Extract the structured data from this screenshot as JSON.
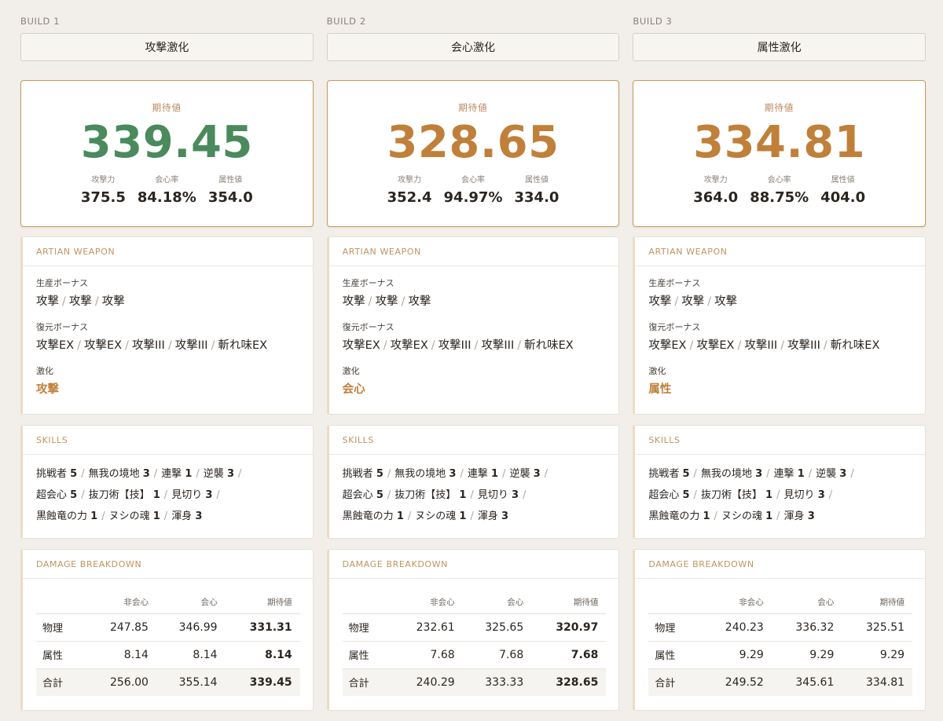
{
  "builds": [
    {
      "label": "BUILD 1",
      "name": "攻撃激化",
      "score_label": "期待値",
      "score": "339.45",
      "stats": [
        {
          "label": "攻撃力",
          "value": "375.5"
        },
        {
          "label": "会心率",
          "value": "84.18%"
        },
        {
          "label": "属性値",
          "value": "354.0"
        }
      ],
      "weapon": {
        "title": "ARTIAN WEAPON",
        "prod_label": "生産ボーナス",
        "prod": [
          "攻撃",
          "攻撃",
          "攻撃"
        ],
        "rest_label": "復元ボーナス",
        "rest": [
          "攻撃EX",
          "攻撃EX",
          "攻撃III",
          "攻撃III",
          "斬れ味EX"
        ],
        "gekika_label": "激化",
        "gekika": "攻撃"
      },
      "skills": {
        "title": "SKILLS",
        "lines": [
          [
            {
              "name": "挑戦者",
              "lv": "5"
            },
            {
              "name": "無我の境地",
              "lv": "3"
            },
            {
              "name": "連撃",
              "lv": "1"
            },
            {
              "name": "逆襲",
              "lv": "3"
            }
          ],
          [
            {
              "name": "超会心",
              "lv": "5"
            },
            {
              "name": "抜刀術【技】",
              "lv": "1"
            },
            {
              "name": "見切り",
              "lv": "3"
            }
          ],
          [
            {
              "name": "黒蝕竜の力",
              "lv": "1"
            },
            {
              "name": "ヌシの魂",
              "lv": "1"
            },
            {
              "name": "渾身",
              "lv": "3"
            }
          ]
        ]
      },
      "damage": {
        "title": "DAMAGE BREAKDOWN",
        "headers": [
          "",
          "非会心",
          "会心",
          "期待値"
        ],
        "rows": [
          {
            "label": "物理",
            "noncrit": "247.85",
            "crit": "346.99",
            "expected": "331.31"
          },
          {
            "label": "属性",
            "noncrit": "8.14",
            "crit": "8.14",
            "expected": "8.14"
          },
          {
            "label": "合計",
            "noncrit": "256.00",
            "crit": "355.14",
            "expected": "339.45"
          }
        ]
      }
    },
    {
      "label": "BUILD 2",
      "name": "会心激化",
      "score_label": "期待値",
      "score": "328.65",
      "stats": [
        {
          "label": "攻撃力",
          "value": "352.4"
        },
        {
          "label": "会心率",
          "value": "94.97%"
        },
        {
          "label": "属性値",
          "value": "334.0"
        }
      ],
      "weapon": {
        "title": "ARTIAN WEAPON",
        "prod_label": "生産ボーナス",
        "prod": [
          "攻撃",
          "攻撃",
          "攻撃"
        ],
        "rest_label": "復元ボーナス",
        "rest": [
          "攻撃EX",
          "攻撃EX",
          "攻撃III",
          "攻撃III",
          "斬れ味EX"
        ],
        "gekika_label": "激化",
        "gekika": "会心"
      },
      "skills": {
        "title": "SKILLS",
        "lines": [
          [
            {
              "name": "挑戦者",
              "lv": "5"
            },
            {
              "name": "無我の境地",
              "lv": "3"
            },
            {
              "name": "連撃",
              "lv": "1"
            },
            {
              "name": "逆襲",
              "lv": "3"
            }
          ],
          [
            {
              "name": "超会心",
              "lv": "5"
            },
            {
              "name": "抜刀術【技】",
              "lv": "1"
            },
            {
              "name": "見切り",
              "lv": "3"
            }
          ],
          [
            {
              "name": "黒蝕竜の力",
              "lv": "1"
            },
            {
              "name": "ヌシの魂",
              "lv": "1"
            },
            {
              "name": "渾身",
              "lv": "3"
            }
          ]
        ]
      },
      "damage": {
        "title": "DAMAGE BREAKDOWN",
        "headers": [
          "",
          "非会心",
          "会心",
          "期待値"
        ],
        "rows": [
          {
            "label": "物理",
            "noncrit": "232.61",
            "crit": "325.65",
            "expected": "320.97"
          },
          {
            "label": "属性",
            "noncrit": "7.68",
            "crit": "7.68",
            "expected": "7.68"
          },
          {
            "label": "合計",
            "noncrit": "240.29",
            "crit": "333.33",
            "expected": "328.65"
          }
        ]
      }
    },
    {
      "label": "BUILD 3",
      "name": "属性激化",
      "score_label": "期待値",
      "score": "334.81",
      "stats": [
        {
          "label": "攻撃力",
          "value": "364.0"
        },
        {
          "label": "会心率",
          "value": "88.75%"
        },
        {
          "label": "属性値",
          "value": "404.0"
        }
      ],
      "weapon": {
        "title": "ARTIAN WEAPON",
        "prod_label": "生産ボーナス",
        "prod": [
          "攻撃",
          "攻撃",
          "攻撃"
        ],
        "rest_label": "復元ボーナス",
        "rest": [
          "攻撃EX",
          "攻撃EX",
          "攻撃III",
          "攻撃III",
          "斬れ味EX"
        ],
        "gekika_label": "激化",
        "gekika": "属性"
      },
      "skills": {
        "title": "SKILLS",
        "lines": [
          [
            {
              "name": "挑戦者",
              "lv": "5"
            },
            {
              "name": "無我の境地",
              "lv": "3"
            },
            {
              "name": "連撃",
              "lv": "1"
            },
            {
              "name": "逆襲",
              "lv": "3"
            }
          ],
          [
            {
              "name": "超会心",
              "lv": "5"
            },
            {
              "name": "抜刀術【技】",
              "lv": "1"
            },
            {
              "name": "見切り",
              "lv": "3"
            }
          ],
          [
            {
              "name": "黒蝕竜の力",
              "lv": "1"
            },
            {
              "name": "ヌシの魂",
              "lv": "1"
            },
            {
              "name": "渾身",
              "lv": "3"
            }
          ]
        ]
      },
      "damage": {
        "title": "DAMAGE BREAKDOWN",
        "headers": [
          "",
          "非会心",
          "会心",
          "期待値"
        ],
        "rows": [
          {
            "label": "物理",
            "noncrit": "240.23",
            "crit": "336.32",
            "expected": "325.51"
          },
          {
            "label": "属性",
            "noncrit": "9.29",
            "crit": "9.29",
            "expected": "9.29"
          },
          {
            "label": "合計",
            "noncrit": "249.52",
            "crit": "345.61",
            "expected": "334.81"
          }
        ]
      }
    }
  ],
  "colors": {
    "best_score": "#4a8a5c",
    "other_score": "#c0803a",
    "accent": "#c0955f"
  },
  "best_build": 0,
  "bold_expected": [
    [
      true,
      true,
      true
    ],
    [
      true,
      true,
      true
    ],
    [
      false,
      false,
      false
    ]
  ]
}
